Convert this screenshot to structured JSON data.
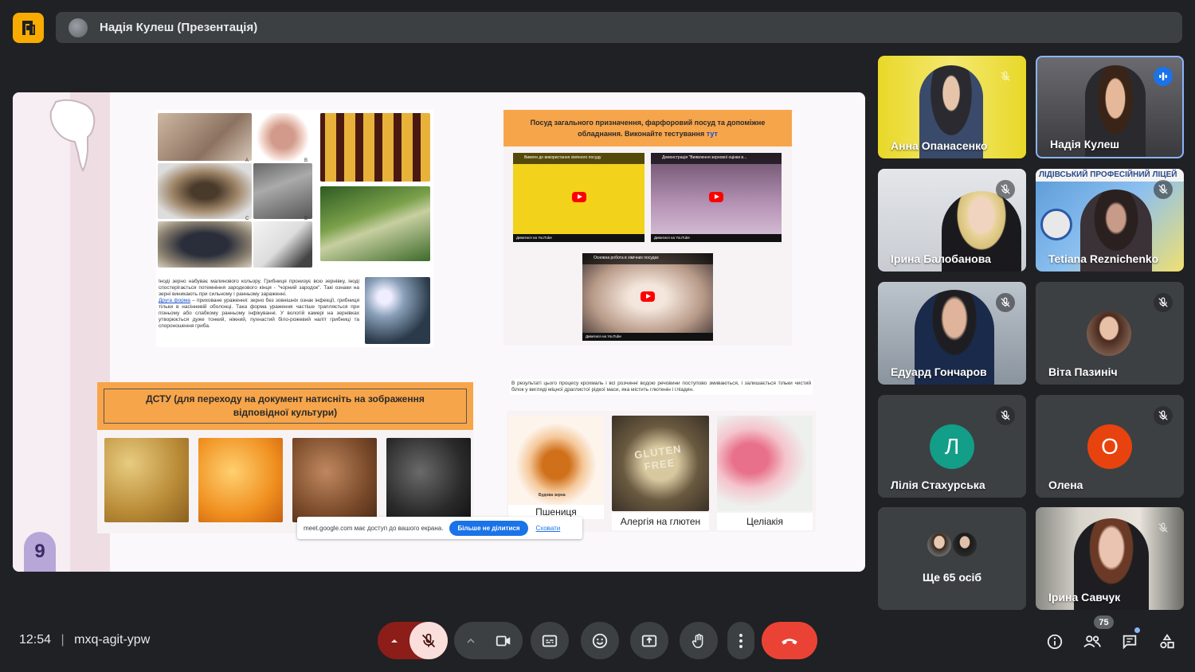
{
  "header": {
    "presenter_title": "Надія Кулеш (Презентація)"
  },
  "slide": {
    "page_number": "9",
    "diseases_text_1": "Іноді зерно набуває малинового кольору. Грибниця пронизує всю зернівку, іноді спостерігається потемніння зародкового кінця - \"чорний зародок\". Такі ознаки на зерні виникають при сильному і ранньому зараженні.",
    "diseases_text_link": "Друга форма",
    "diseases_text_2": " – приховане ураження: зерно без зовнішніх ознак інфекції, грибниця тільки в насінневій оболонці. Така форма ураження частіше трапляється при пізньому або слабкому ранньому інфікуванні. У вологій камері на зернівках утворюється дуже тонкий, ніжний, пухнастий біло-рожевий наліт грибниці та спороношення гриба.",
    "dishes_header_main": "Посуд загального призначення, фарфоровий посуд та допоміжне обладнання. Виконайте тестування ",
    "dishes_header_link": "тут",
    "video1_title": "Вимоги до використання хімічного посуду",
    "video2_title": "Демонстрація \"Виявлення зернової оцінки в...",
    "video3_title": "Основна робота в хімічних посудах",
    "yt_watch": "Дивитися на YouTube",
    "dstu_header": "ДСТУ (для переходу на документ натисніть на зображення відповідної культури)",
    "process_text": "В результаті цього процесу крохмаль і всі розчинні водою речовини поступово змиваються, і залишається тільки чистий білок у вигляді міцної драглистої рідкої маси, яка містить глютенін і гліадин.",
    "grain_part_label": "Будова зерна",
    "gluten_sign": "GLUTEN FREE",
    "cards": [
      {
        "label": "Пшениця"
      },
      {
        "label": "Алергія на глютен"
      },
      {
        "label": "Целіакія"
      }
    ],
    "photo_letters": [
      "A",
      "B",
      "C",
      "D"
    ]
  },
  "share_notice": {
    "text": "meet.google.com має доступ до вашого екрана.",
    "stop_button": "Більше не ділитися",
    "hide_link": "Сховати"
  },
  "participants": [
    {
      "name": "Анна Опанасенко",
      "muted": true
    },
    {
      "name": "Надія Кулеш",
      "muted": false,
      "speaking": true
    },
    {
      "name": "Ірина Балобанова",
      "muted": true
    },
    {
      "name": "Tetiana Reznichenko",
      "muted": true,
      "banner": "ЛІДІВСЬКИЙ ПРОФЕСІЙНИЙ ЛІЦЕЙ"
    },
    {
      "name": "Едуард Гончаров",
      "muted": true
    },
    {
      "name": "Віта Пазиніч",
      "muted": true
    },
    {
      "name": "Лілія Стахурська",
      "muted": true,
      "initial": "Л",
      "color": "#129e88"
    },
    {
      "name": "Олена",
      "muted": true,
      "initial": "О",
      "color": "#e8430f"
    },
    {
      "name": "Ще 65 осіб",
      "muted": false
    },
    {
      "name": "Ірина Савчук",
      "muted": true
    }
  ],
  "footer": {
    "time": "12:54",
    "separator": "|",
    "meeting_code": "mxq-agit-ypw",
    "participant_count": "75"
  },
  "colors": {
    "background": "#202124",
    "tile": "#3c4043",
    "end_call": "#ea4335",
    "muted_mic": "#f9dedc",
    "accent_blue": "#1a73e8",
    "logo": "#f9ab00"
  }
}
